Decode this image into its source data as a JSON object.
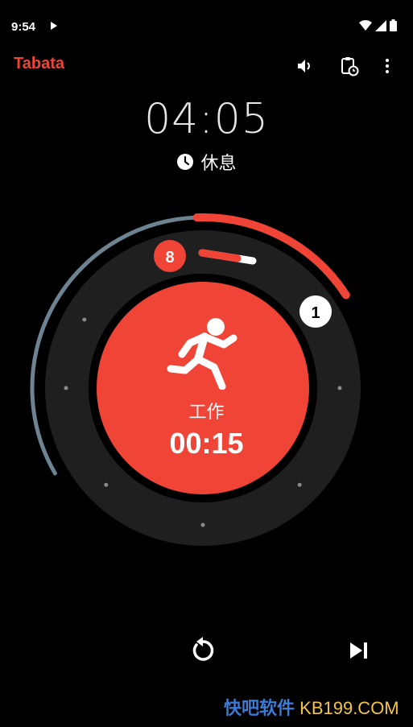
{
  "status_bar": {
    "time": "9:54"
  },
  "app_bar": {
    "title": "Tabata"
  },
  "session": {
    "total_remaining": "04:05",
    "next_phase_label": "休息",
    "rounds_remaining": "8",
    "current_set": "1",
    "round_progress": 0.3,
    "session_progress": 0.75
  },
  "current_interval": {
    "label": "工作",
    "remaining": "00:15"
  },
  "watermark": {
    "cn": "快吧软件",
    "en": "KB199.COM"
  },
  "colors": {
    "accent": "#ef4436",
    "ring": "#1f1f1f",
    "progress_track": "#6d8391",
    "background": "#000000"
  },
  "icons": {
    "volume": "volume-icon",
    "clipboard": "clipboard-timer-icon",
    "more": "more-vert-icon",
    "clock": "clock-icon",
    "runner": "runner-icon",
    "restart": "restart-icon",
    "skip": "skip-next-icon"
  }
}
